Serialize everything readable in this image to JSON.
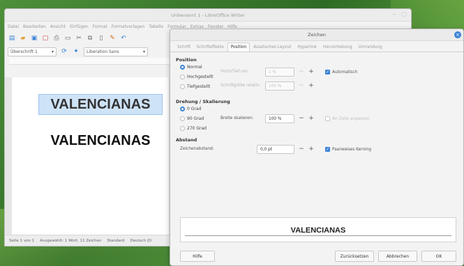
{
  "writer": {
    "title": "Unbenannt 1 - LibreOffice Writer",
    "menu": [
      "Datei",
      "Bearbeiten",
      "Ansicht",
      "Einfügen",
      "Format",
      "Formatvorlagen",
      "Tabelle",
      "Formular",
      "Extras",
      "Fenster",
      "Hilfe"
    ],
    "style_combo": "Überschrift 1",
    "font_combo": "Liberation Sans",
    "heading_selected": "VALENCIANAS",
    "heading_plain": "VALENCIANAS",
    "status": {
      "page": "Seite 1 von 1",
      "selection": "Ausgewählt: 1 Wort, 11 Zeichen",
      "page_style": "Standard",
      "language": "Deutsch (D"
    }
  },
  "dialog": {
    "title": "Zeichen",
    "tabs": [
      "Schrift",
      "Schrifteffekte",
      "Position",
      "Asiatisches Layout",
      "Hyperlink",
      "Hervorhebung",
      "Umrandung"
    ],
    "active_tab": "Position",
    "position": {
      "section": "Position",
      "normal": "Normal",
      "hochgestellt": "Hochgestellt",
      "tiefgestellt": "Tiefgestellt",
      "raise_label": "Hoch/Tief um:",
      "raise_value": "1 %",
      "size_label": "Schriftgröße relativ:",
      "size_value": "100 %",
      "auto_label": "Automatisch"
    },
    "rotation": {
      "section": "Drehung / Skalierung",
      "deg0": "0 Grad",
      "deg90": "90 Grad",
      "deg270": "270 Grad",
      "scale_label": "Breite skalieren:",
      "scale_value": "100 %",
      "fit_label": "An Zeile anpassen"
    },
    "spacing": {
      "section": "Abstand",
      "label": "Zeichenabstand:",
      "value": "0,0 pt",
      "kerning": "Paarweises Kerning"
    },
    "preview_text": "VALENCIANAS",
    "buttons": {
      "help": "Hilfe",
      "reset": "Zurücksetzen",
      "cancel": "Abbrechen",
      "ok": "OK"
    }
  },
  "colors": {
    "accent": "#3d84d6",
    "selection": "#cfe3f7"
  }
}
